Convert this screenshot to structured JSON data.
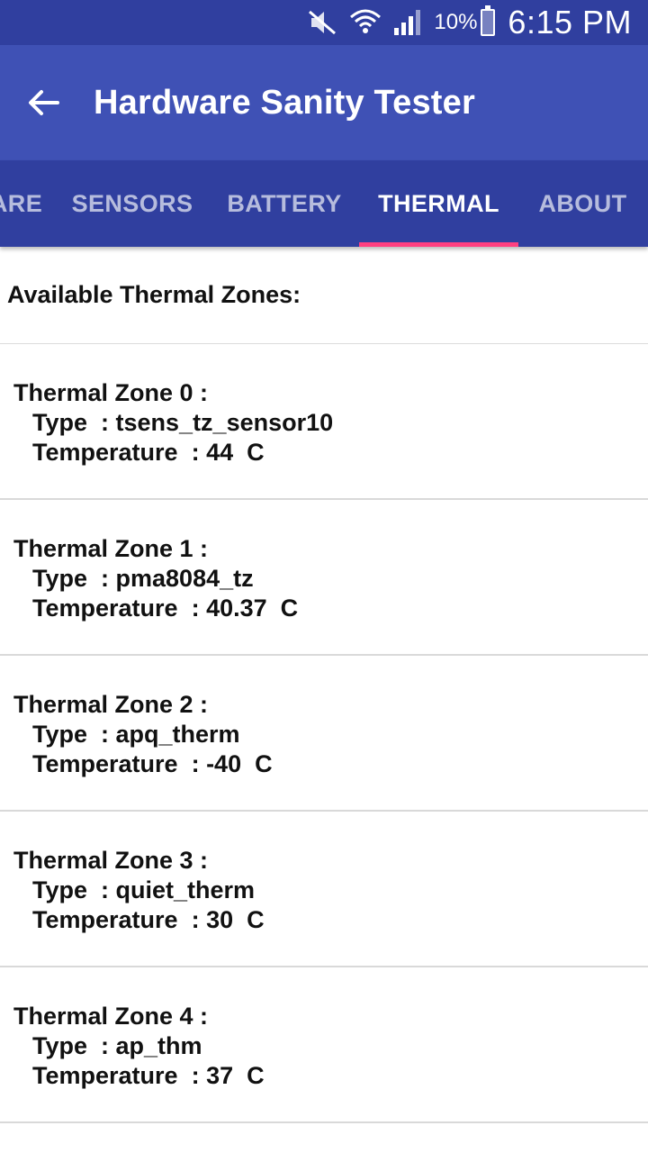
{
  "status_bar": {
    "battery_percent": "10%",
    "time": "6:15 PM",
    "icons": [
      "mute-icon",
      "wifi-icon",
      "signal-icon",
      "battery-icon"
    ]
  },
  "app_bar": {
    "title": "Hardware Sanity Tester",
    "back_icon": "back-arrow-icon"
  },
  "tabs": {
    "items": [
      {
        "label": "ARE"
      },
      {
        "label": "SENSORS"
      },
      {
        "label": "BATTERY"
      },
      {
        "label": "THERMAL"
      },
      {
        "label": "ABOUT"
      }
    ],
    "active": "THERMAL"
  },
  "content": {
    "header": "Available Thermal Zones:",
    "zones": [
      {
        "title": "Thermal Zone 0 :",
        "type_label": "Type",
        "type": "tsens_tz_sensor10",
        "temp_label": "Temperature",
        "temperature": "44",
        "unit": "C"
      },
      {
        "title": "Thermal Zone 1 :",
        "type_label": "Type",
        "type": "pma8084_tz",
        "temp_label": "Temperature",
        "temperature": "40.37",
        "unit": "C"
      },
      {
        "title": "Thermal Zone 2 :",
        "type_label": "Type",
        "type": "apq_therm",
        "temp_label": "Temperature",
        "temperature": "-40",
        "unit": "C"
      },
      {
        "title": "Thermal Zone 3 :",
        "type_label": "Type",
        "type": "quiet_therm",
        "temp_label": "Temperature",
        "temperature": "30",
        "unit": "C"
      },
      {
        "title": "Thermal Zone 4 :",
        "type_label": "Type",
        "type": "ap_thm",
        "temp_label": "Temperature",
        "temperature": "37",
        "unit": "C"
      }
    ]
  },
  "colors": {
    "status_bar": "#303f9f",
    "app_bar": "#3f51b5",
    "tab_bar": "#303f9f",
    "tab_indicator": "#ff4081"
  }
}
